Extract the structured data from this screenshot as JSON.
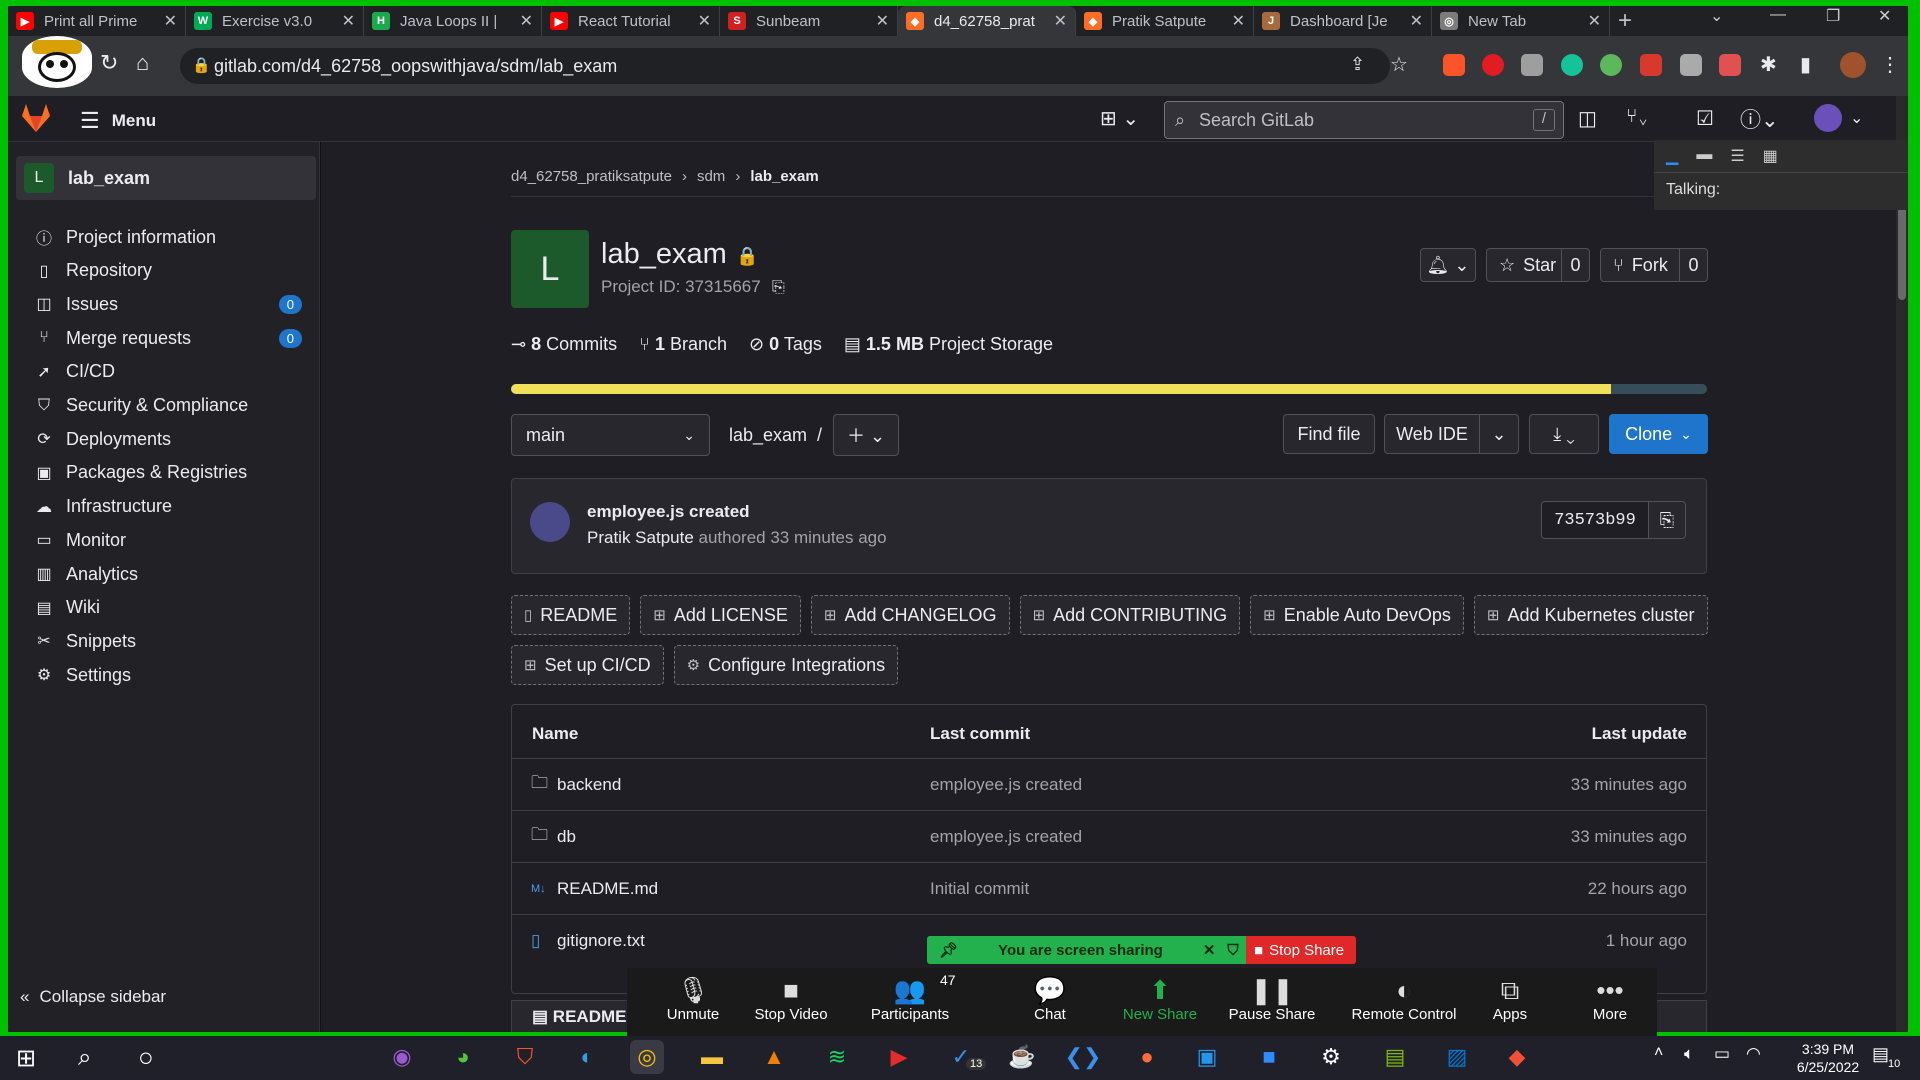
{
  "browser": {
    "tabs": [
      {
        "title": "Print all Prime",
        "color": "#ff0000",
        "glyph": "▶"
      },
      {
        "title": "Exercise v3.0",
        "color": "#00aa55",
        "glyph": "W"
      },
      {
        "title": "Java Loops II |",
        "color": "#1ba94c",
        "glyph": "H"
      },
      {
        "title": "React Tutorial",
        "color": "#ff0000",
        "glyph": "▶"
      },
      {
        "title": "Sunbeam",
        "color": "#d02020",
        "glyph": "S"
      },
      {
        "title": "d4_62758_prat",
        "color": "#fc6d26",
        "glyph": "◆"
      },
      {
        "title": "Pratik Satpute",
        "color": "#fc6d26",
        "glyph": "◆"
      },
      {
        "title": "Dashboard [Je",
        "color": "#a86a3c",
        "glyph": "J"
      },
      {
        "title": "New Tab",
        "color": "#7c7c7c",
        "glyph": "◎"
      }
    ],
    "active_tab_index": 5,
    "url": "gitlab.com/d4_62758_oopswithjava/sdm/lab_exam"
  },
  "gitlab": {
    "menu_label": "Menu",
    "search_placeholder": "Search GitLab",
    "search_shortcut": "/",
    "project_letter": "L",
    "project_name": "lab_exam",
    "sidebar": {
      "items": [
        {
          "label": "Project information",
          "icon": "info-icon",
          "glyph": "ⓘ"
        },
        {
          "label": "Repository",
          "icon": "doc-icon",
          "glyph": "▯"
        },
        {
          "label": "Issues",
          "icon": "issues-icon",
          "glyph": "◫",
          "badge": "0"
        },
        {
          "label": "Merge requests",
          "icon": "merge-icon",
          "glyph": "⑂",
          "badge": "0"
        },
        {
          "label": "CI/CD",
          "icon": "rocket-icon",
          "glyph": "➚"
        },
        {
          "label": "Security & Compliance",
          "icon": "shield-icon",
          "glyph": "⛉"
        },
        {
          "label": "Deployments",
          "icon": "deploy-icon",
          "glyph": "⟳"
        },
        {
          "label": "Packages & Registries",
          "icon": "package-icon",
          "glyph": "▣"
        },
        {
          "label": "Infrastructure",
          "icon": "cloud-icon",
          "glyph": "☁"
        },
        {
          "label": "Monitor",
          "icon": "monitor-icon",
          "glyph": "▭"
        },
        {
          "label": "Analytics",
          "icon": "chart-icon",
          "glyph": "▥"
        },
        {
          "label": "Wiki",
          "icon": "book-icon",
          "glyph": "▤"
        },
        {
          "label": "Snippets",
          "icon": "scissors-icon",
          "glyph": "✂"
        },
        {
          "label": "Settings",
          "icon": "gear-icon",
          "glyph": "⚙"
        }
      ],
      "collapse_label": "Collapse sidebar"
    },
    "breadcrumb": [
      "d4_62758_pratiksatpute",
      "sdm",
      "lab_exam"
    ],
    "project_id": "Project ID: 37315667",
    "stats": [
      {
        "bold": "8",
        "text": "Commits"
      },
      {
        "bold": "1",
        "text": "Branch"
      },
      {
        "bold": "0",
        "text": "Tags"
      },
      {
        "bold": "1.5 MB",
        "text": "Project Storage"
      }
    ],
    "star_label": "Star",
    "star_count": "0",
    "fork_label": "Fork",
    "fork_count": "0",
    "language_bar": [
      {
        "fraction": 0.92,
        "color": "#f1e05a"
      },
      {
        "fraction": 0.08,
        "color": "#384d5a"
      }
    ],
    "branch": "main",
    "path": "lab_exam",
    "path_sep": "/",
    "find_file": "Find file",
    "web_ide": "Web IDE",
    "clone": "Clone",
    "last_commit": {
      "title": "employee.js created",
      "author": "Pratik Satpute",
      "meta": "authored 33 minutes ago",
      "sha": "73573b99"
    },
    "quick_buttons_row1": [
      "README",
      "Add LICENSE",
      "Add CHANGELOG",
      "Add CONTRIBUTING",
      "Enable Auto DevOps",
      "Add Kubernetes cluster"
    ],
    "quick_buttons_row2": [
      "Set up CI/CD",
      "Configure Integrations"
    ],
    "table": {
      "headers": [
        "Name",
        "Last commit",
        "Last update"
      ],
      "rows": [
        {
          "name": "backend",
          "type": "folder",
          "commit": "employee.js created",
          "updated": "33 minutes ago"
        },
        {
          "name": "db",
          "type": "folder",
          "commit": "employee.js created",
          "updated": "33 minutes ago"
        },
        {
          "name": "README.md",
          "type": "markdown",
          "commit": "Initial commit",
          "updated": "22 hours ago"
        },
        {
          "name": "gitignore.txt",
          "type": "file",
          "commit": "",
          "updated": "1 hour ago"
        }
      ]
    },
    "readme_heading": "README"
  },
  "zoom": {
    "sharing_text": "You are screen sharing",
    "stop_share": "Stop Share",
    "talking": "Talking:",
    "participants_count": "47",
    "buttons": [
      {
        "label": "Unmute",
        "glyph": "🎙"
      },
      {
        "label": "Stop Video",
        "glyph": "■"
      },
      {
        "label": "Participants",
        "glyph": "👥"
      },
      {
        "label": "Chat",
        "glyph": "💬"
      },
      {
        "label": "New Share",
        "glyph": "⬆"
      },
      {
        "label": "Pause Share",
        "glyph": "❚❚"
      },
      {
        "label": "Remote Control",
        "glyph": "◐"
      },
      {
        "label": "Apps",
        "glyph": "⧉"
      },
      {
        "label": "More",
        "glyph": "•••"
      }
    ]
  },
  "taskbar": {
    "time": "3:39 PM",
    "date": "6/25/2022",
    "vscode_badge": "13",
    "notif_count": "10"
  }
}
